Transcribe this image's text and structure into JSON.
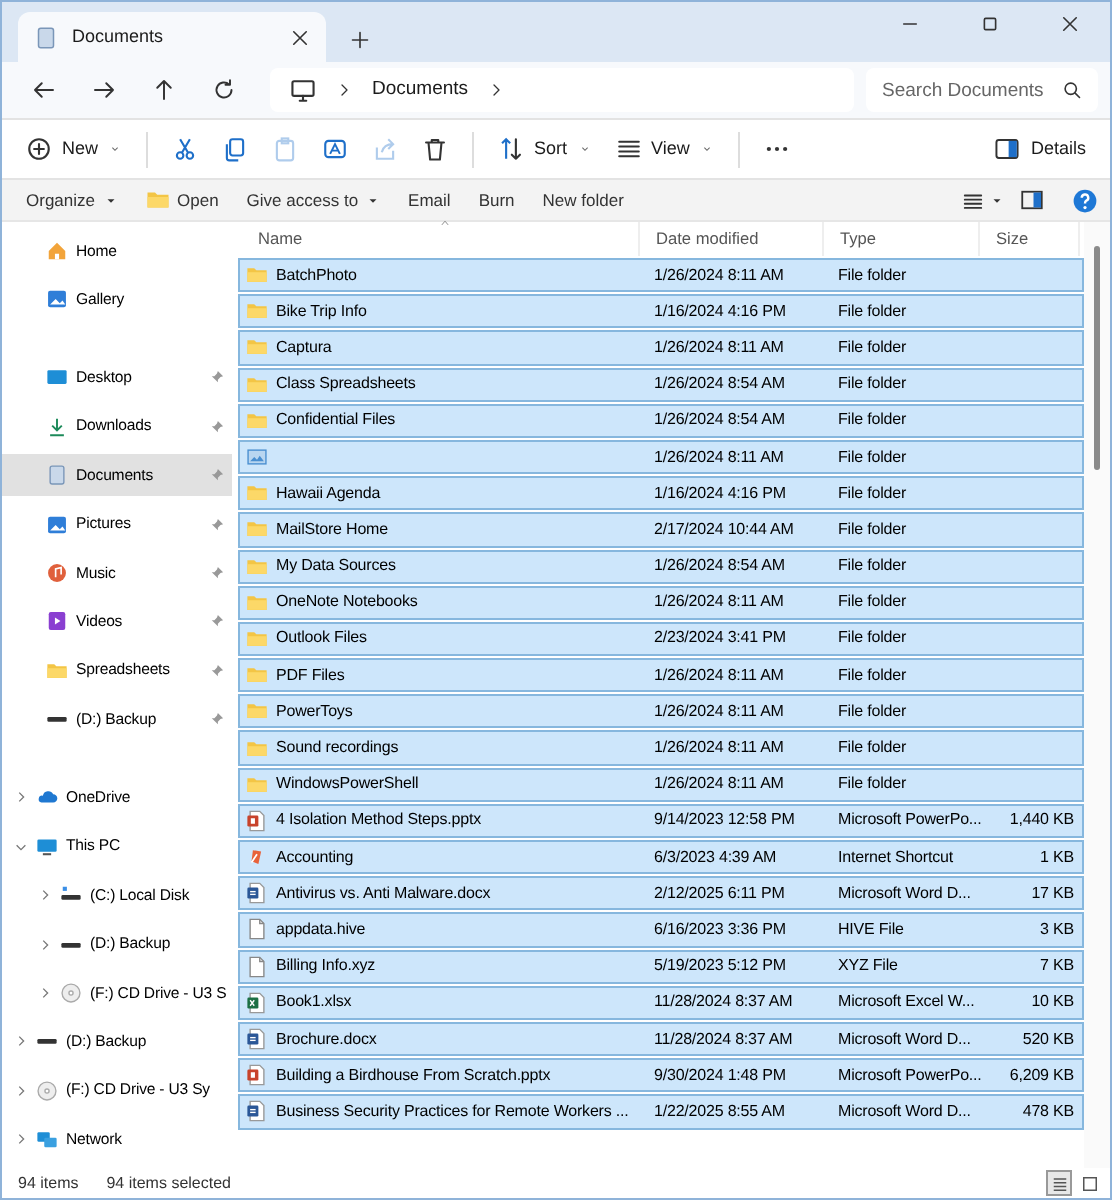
{
  "window": {
    "tab_title": "Documents"
  },
  "address": {
    "crumbs": [
      "Documents"
    ],
    "search_placeholder": "Search Documents"
  },
  "toolbar": [
    {
      "kind": "new",
      "label": "New",
      "menu": true,
      "disabled": false
    },
    {
      "kind": "cut",
      "disabled": false
    },
    {
      "kind": "copy",
      "disabled": false
    },
    {
      "kind": "paste",
      "disabled": true
    },
    {
      "kind": "rename",
      "disabled": false
    },
    {
      "kind": "share",
      "disabled": true
    },
    {
      "kind": "delete",
      "disabled": false
    },
    {
      "kind": "sort",
      "label": "Sort",
      "menu": true,
      "disabled": false
    },
    {
      "kind": "view",
      "label": "View",
      "menu": true,
      "disabled": false
    },
    {
      "kind": "more",
      "disabled": false
    },
    {
      "kind": "details",
      "label": "Details",
      "disabled": false
    }
  ],
  "command_bar": [
    {
      "label": "Organize",
      "menu": true
    },
    {
      "label": "Open",
      "kind": "open"
    },
    {
      "label": "Give access to",
      "menu": true
    },
    {
      "label": "Email"
    },
    {
      "label": "Burn"
    },
    {
      "label": "New folder"
    }
  ],
  "nav_pane": {
    "quick": [
      {
        "label": "Home",
        "kind": "home",
        "selected": false
      },
      {
        "label": "Gallery",
        "kind": "gallery",
        "selected": false
      }
    ],
    "pinned": [
      {
        "label": "Desktop",
        "kind": "desktop",
        "selected": false,
        "pinned": true
      },
      {
        "label": "Downloads",
        "kind": "downloads",
        "selected": false,
        "pinned": true
      },
      {
        "label": "Documents",
        "kind": "documents",
        "selected": true,
        "pinned": true
      },
      {
        "label": "Pictures",
        "kind": "pictures",
        "selected": false,
        "pinned": true
      },
      {
        "label": "Music",
        "kind": "music",
        "selected": false,
        "pinned": true
      },
      {
        "label": "Videos",
        "kind": "videos",
        "selected": false,
        "pinned": true
      },
      {
        "label": "Spreadsheets",
        "kind": "folder",
        "selected": false,
        "pinned": true
      },
      {
        "label": "(D:) Backup",
        "kind": "drive",
        "selected": false,
        "pinned": true
      }
    ],
    "tree": [
      {
        "label": "OneDrive",
        "kind": "cloud",
        "expanded": false,
        "selected": false
      },
      {
        "label": "This PC",
        "kind": "pc",
        "expanded": true,
        "selected": false,
        "children": [
          {
            "label": "(C:) Local Disk",
            "kind": "system-drive",
            "expanded": false,
            "selected": false
          },
          {
            "label": "(D:) Backup",
            "kind": "drive",
            "expanded": false,
            "selected": false
          },
          {
            "label": "(F:) CD Drive - U3 S",
            "kind": "cd",
            "expanded": false,
            "selected": false
          }
        ]
      },
      {
        "label": "(D:) Backup",
        "kind": "drive",
        "expanded": false,
        "selected": false
      },
      {
        "label": "(F:) CD Drive - U3 Sy",
        "kind": "cd",
        "expanded": false,
        "selected": false
      },
      {
        "label": "Network",
        "kind": "network",
        "expanded": false,
        "selected": false
      }
    ]
  },
  "table": {
    "columns": [
      {
        "label": "Name",
        "sorted": true
      },
      {
        "label": "Date modified",
        "sorted": false
      },
      {
        "label": "Type",
        "sorted": false
      },
      {
        "label": "Size",
        "sorted": false
      }
    ],
    "rows": [
      {
        "kind": "folder",
        "name": "BatchPhoto",
        "date": "1/26/2024 8:11 AM",
        "type": "File folder",
        "selected": true
      },
      {
        "kind": "folder",
        "name": "Bike Trip Info",
        "date": "1/16/2024 4:16 PM",
        "type": "File folder",
        "selected": true
      },
      {
        "kind": "folder",
        "name": "Captura",
        "date": "1/26/2024 8:11 AM",
        "type": "File folder",
        "selected": true
      },
      {
        "kind": "folder",
        "name": "Class Spreadsheets",
        "date": "1/26/2024 8:54 AM",
        "type": "File folder",
        "selected": true
      },
      {
        "kind": "folder",
        "name": "Confidential Files",
        "date": "1/26/2024 8:54 AM",
        "type": "File folder",
        "selected": true
      },
      {
        "kind": "image",
        "date": "1/26/2024 8:11 AM",
        "type": "File folder",
        "selected": true
      },
      {
        "kind": "folder",
        "name": "Hawaii Agenda",
        "date": "1/16/2024 4:16 PM",
        "type": "File folder",
        "selected": true
      },
      {
        "kind": "folder",
        "name": "MailStore Home",
        "date": "2/17/2024 10:44 AM",
        "type": "File folder",
        "selected": true
      },
      {
        "kind": "folder",
        "name": "My Data Sources",
        "date": "1/26/2024 8:54 AM",
        "type": "File folder",
        "selected": true
      },
      {
        "kind": "folder",
        "name": "OneNote Notebooks",
        "date": "1/26/2024 8:11 AM",
        "type": "File folder",
        "selected": true
      },
      {
        "kind": "folder",
        "name": "Outlook Files",
        "date": "2/23/2024 3:41 PM",
        "type": "File folder",
        "selected": true
      },
      {
        "kind": "folder",
        "name": "PDF Files",
        "date": "1/26/2024 8:11 AM",
        "type": "File folder",
        "selected": true
      },
      {
        "kind": "folder",
        "name": "PowerToys",
        "date": "1/26/2024 8:11 AM",
        "type": "File folder",
        "selected": true
      },
      {
        "kind": "folder",
        "name": "Sound recordings",
        "date": "1/26/2024 8:11 AM",
        "type": "File folder",
        "selected": true
      },
      {
        "kind": "folder",
        "name": "WindowsPowerShell",
        "date": "1/26/2024 8:11 AM",
        "type": "File folder",
        "selected": true
      },
      {
        "kind": "pptx",
        "name": "4 Isolation Method Steps.pptx",
        "date": "9/14/2023 12:58 PM",
        "type": "Microsoft PowerPo...",
        "size": "1,440 KB",
        "selected": true
      },
      {
        "kind": "shortcut",
        "name": "Accounting",
        "date": "6/3/2023 4:39 AM",
        "type": "Internet Shortcut",
        "size": "1 KB",
        "selected": true
      },
      {
        "kind": "docx",
        "name": "Antivirus vs. Anti Malware.docx",
        "date": "2/12/2025 6:11 PM",
        "type": "Microsoft Word D...",
        "size": "17 KB",
        "selected": true
      },
      {
        "kind": "file",
        "name": "appdata.hive",
        "date": "6/16/2023 3:36 PM",
        "type": "HIVE File",
        "size": "3 KB",
        "selected": true
      },
      {
        "kind": "file",
        "name": "Billing Info.xyz",
        "date": "5/19/2023 5:12 PM",
        "type": "XYZ File",
        "size": "7 KB",
        "selected": true
      },
      {
        "kind": "xlsx",
        "name": "Book1.xlsx",
        "date": "11/28/2024 8:37 AM",
        "type": "Microsoft Excel W...",
        "size": "10 KB",
        "selected": true
      },
      {
        "kind": "docx",
        "name": "Brochure.docx",
        "date": "11/28/2024 8:37 AM",
        "type": "Microsoft Word D...",
        "size": "520 KB",
        "selected": true
      },
      {
        "kind": "pptx",
        "name": "Building a Birdhouse From Scratch.pptx",
        "date": "9/30/2024 1:48 PM",
        "type": "Microsoft PowerPo...",
        "size": "6,209 KB",
        "selected": true
      },
      {
        "kind": "docx",
        "name": "Business Security Practices for Remote Workers ...",
        "date": "1/22/2025 8:55 AM",
        "type": "Microsoft Word D...",
        "size": "478 KB",
        "selected": true
      }
    ]
  },
  "status_bar": {
    "item_count": "94 items",
    "selection": "94 items selected",
    "view_modes": [
      {
        "kind": "details",
        "selected": true
      },
      {
        "kind": "tiles",
        "selected": false
      }
    ]
  }
}
